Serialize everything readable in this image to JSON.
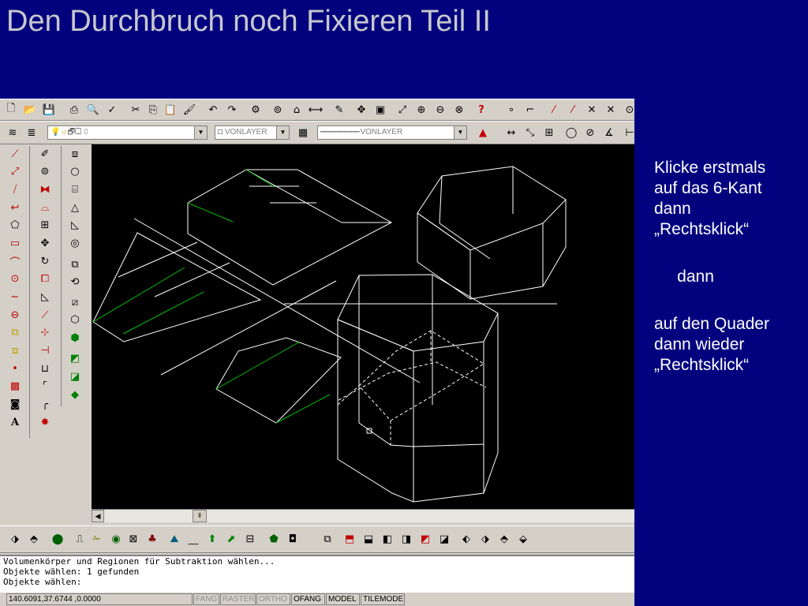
{
  "slide": {
    "title": "Den Durchbruch noch Fixieren Teil II"
  },
  "notes": [
    [
      "Klicke erstmals",
      "auf das 6-Kant",
      "dann",
      "„Rechtsklick“"
    ],
    [
      " dann"
    ],
    [
      "auf den Quader",
      "dann wieder",
      "„Rechtsklick“"
    ]
  ],
  "toolbar": {
    "layer_value": "0",
    "color_value": "VONLAYER",
    "linetype_value": "VONLAYER"
  },
  "command": {
    "lines": [
      "Volumenkörper und Regionen für Subtraktion wählen...",
      "Objekte wählen: 1 gefunden",
      "Objekte wählen:"
    ]
  },
  "status": {
    "coordinates": "140.6091,37.6744 ,0.0000",
    "modes": [
      "FANG",
      "RASTER",
      "ORTHO",
      "OFANG",
      "MODEL",
      "TILEMODE"
    ],
    "active_modes": [
      "OFANG",
      "MODEL",
      "TILEMODE"
    ]
  },
  "colors": {
    "slide_background": "#02027f",
    "title": "#c8c8cc",
    "drawing_lines": "#ffffff",
    "drawing_highlight": "#00c000"
  }
}
